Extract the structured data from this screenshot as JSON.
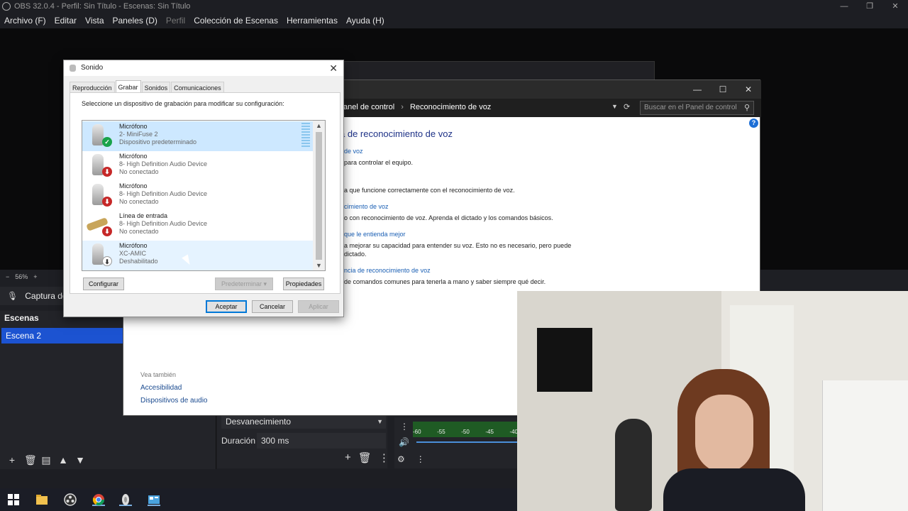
{
  "obs": {
    "title": "OBS 32.0.4 - Perfil: Sin Título - Escenas: Sin Título",
    "menu": [
      "Archivo (F)",
      "Editar",
      "Vista",
      "Paneles (D)",
      "Perfil",
      "Colección de Escenas",
      "Herramientas",
      "Ayuda (H)"
    ],
    "zoom": "56%",
    "source_label": "Captura de e",
    "scenes_header": "Escenas",
    "scene_selected": "Escena 2",
    "transition": "Desvanecimiento",
    "duration_label": "Duración",
    "duration_value": "300 ms",
    "meter_ticks": [
      "-60",
      "-55",
      "-50",
      "-45",
      "-40"
    ]
  },
  "control_panel": {
    "breadcrumb": [
      "anel de control",
      "Reconocimiento de voz"
    ],
    "search_placeholder": "Buscar en el Panel de control",
    "heading": "a de reconocimiento de voz",
    "lines": [
      "de voz",
      "para controlar el equipo.",
      "a que funcione correctamente con el reconocimiento de voz.",
      "cimiento de voz",
      "o con reconocimiento de voz. Aprenda el dictado y los comandos básicos.",
      "que le entienda mejor",
      "a mejorar su capacidad para entender su voz. Esto no es necesario, pero puede",
      "dictado.",
      "ncia de reconocimiento de voz",
      "de comandos comunes para tenerla a mano y saber siempre qué decir."
    ],
    "see_also": "Vea también",
    "see_links": [
      "Accesibilidad",
      "Dispositivos de audio"
    ]
  },
  "sound_dialog": {
    "title": "Sonido",
    "tabs": [
      "Reproducción",
      "Grabar",
      "Sonidos",
      "Comunicaciones"
    ],
    "active_tab": "Grabar",
    "instruction": "Seleccione un dispositivo de grabación para modificar su configuración:",
    "devices": [
      {
        "name": "Micrófono",
        "device": "2- MiniFuse 2",
        "status": "Dispositivo predeterminado",
        "icon": "microphone-icon",
        "badge": "check-icon",
        "state": "selected"
      },
      {
        "name": "Micrófono",
        "device": "8- High Definition Audio Device",
        "status": "No conectado",
        "icon": "microphone-icon",
        "badge": "down-arrow-red-icon",
        "state": "normal"
      },
      {
        "name": "Micrófono",
        "device": "8- High Definition Audio Device",
        "status": "No conectado",
        "icon": "microphone-icon",
        "badge": "down-arrow-red-icon",
        "state": "normal"
      },
      {
        "name": "Línea de entrada",
        "device": "8- High Definition Audio Device",
        "status": "No conectado",
        "icon": "line-in-cable-icon",
        "badge": "down-arrow-red-icon",
        "state": "normal"
      },
      {
        "name": "Micrófono",
        "device": "XC-AMIC",
        "status": "Deshabilitado",
        "icon": "microphone-icon",
        "badge": "down-arrow-icon",
        "state": "hover"
      }
    ],
    "buttons": {
      "configure": "Configurar",
      "set_default": "Predeterminar",
      "properties": "Propiedades",
      "ok": "Aceptar",
      "cancel": "Cancelar",
      "apply": "Aplicar"
    }
  },
  "taskbar": {
    "icons": [
      "windows-start-icon",
      "file-explorer-icon",
      "obs-icon",
      "chrome-icon",
      "sound-app-icon",
      "control-panel-icon"
    ]
  }
}
